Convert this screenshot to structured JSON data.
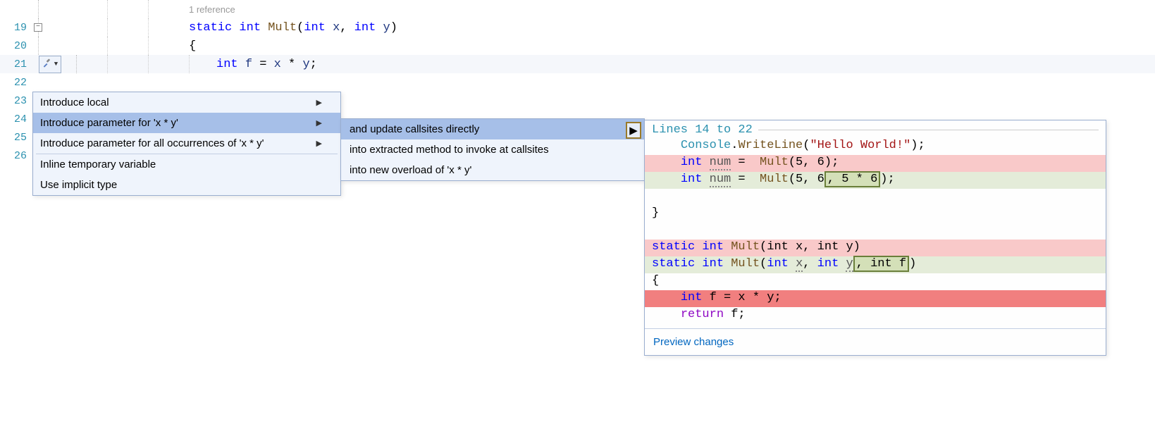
{
  "editor": {
    "lines": {
      "l19": "19",
      "l20": "20",
      "l21": "21",
      "l22": "22",
      "l23": "23",
      "l24": "24",
      "l25": "25",
      "l26": "26"
    },
    "codelens": "1 reference",
    "sig_static": "static",
    "sig_int": "int",
    "sig_mult": "Mult",
    "sig_paren_open": "(",
    "sig_x": "x",
    "sig_comma": ", ",
    "sig_y": "y",
    "sig_paren_close": ")",
    "brace_open": "{",
    "decl_int": "int",
    "decl_f": "f",
    "decl_eq": " = ",
    "decl_x": "x",
    "decl_star": " * ",
    "decl_y": "y",
    "decl_semi": ";"
  },
  "menu1": {
    "items": [
      {
        "label": "Introduce local",
        "arrow": true
      },
      {
        "label": "Introduce parameter for 'x * y'",
        "arrow": true,
        "selected": true
      },
      {
        "label": "Introduce parameter for all occurrences of 'x * y'",
        "arrow": true
      },
      {
        "sep": true
      },
      {
        "label": "Inline temporary variable",
        "arrow": false
      },
      {
        "label": "Use implicit type",
        "arrow": false
      }
    ]
  },
  "menu2": {
    "items": [
      {
        "label": "and update callsites directly",
        "selected": true,
        "arrow": true
      },
      {
        "label": "into extracted method to invoke at callsites"
      },
      {
        "label": "into new overload of 'x * y'"
      }
    ]
  },
  "preview": {
    "header": "Lines 14 to 22",
    "footer": "Preview changes",
    "p_console": "Console",
    "p_dot": ".",
    "p_writeline": "WriteLine",
    "p_open": "(",
    "p_str": "\"Hello World!\"",
    "p_close_semi": ");",
    "p_int": "int",
    "p_num": "num",
    "p_eq": " =  ",
    "p_mult": "Mult",
    "p_args_old": "(5, 6);",
    "p_args_new_pre": "(5, 6",
    "p_args_new_box": ", 5 * 6",
    "p_args_new_post": ");",
    "p_brace_close": "}",
    "p_static": "static",
    "p_mult_decl": "Mult",
    "p_old_params": "(int x, int y)",
    "p_new_params_pre_open": "(",
    "p_new_int": "int",
    "p_new_x": "x",
    "p_new_comma": ", ",
    "p_new_y": "y",
    "p_new_box": ", int f",
    "p_new_close": ")",
    "p_brace_open": "{",
    "p_body_del_int": "int",
    "p_body_del_f": "f",
    "p_body_del_eq": " = x * y;",
    "p_return": "return",
    "p_return_f": " f;"
  }
}
